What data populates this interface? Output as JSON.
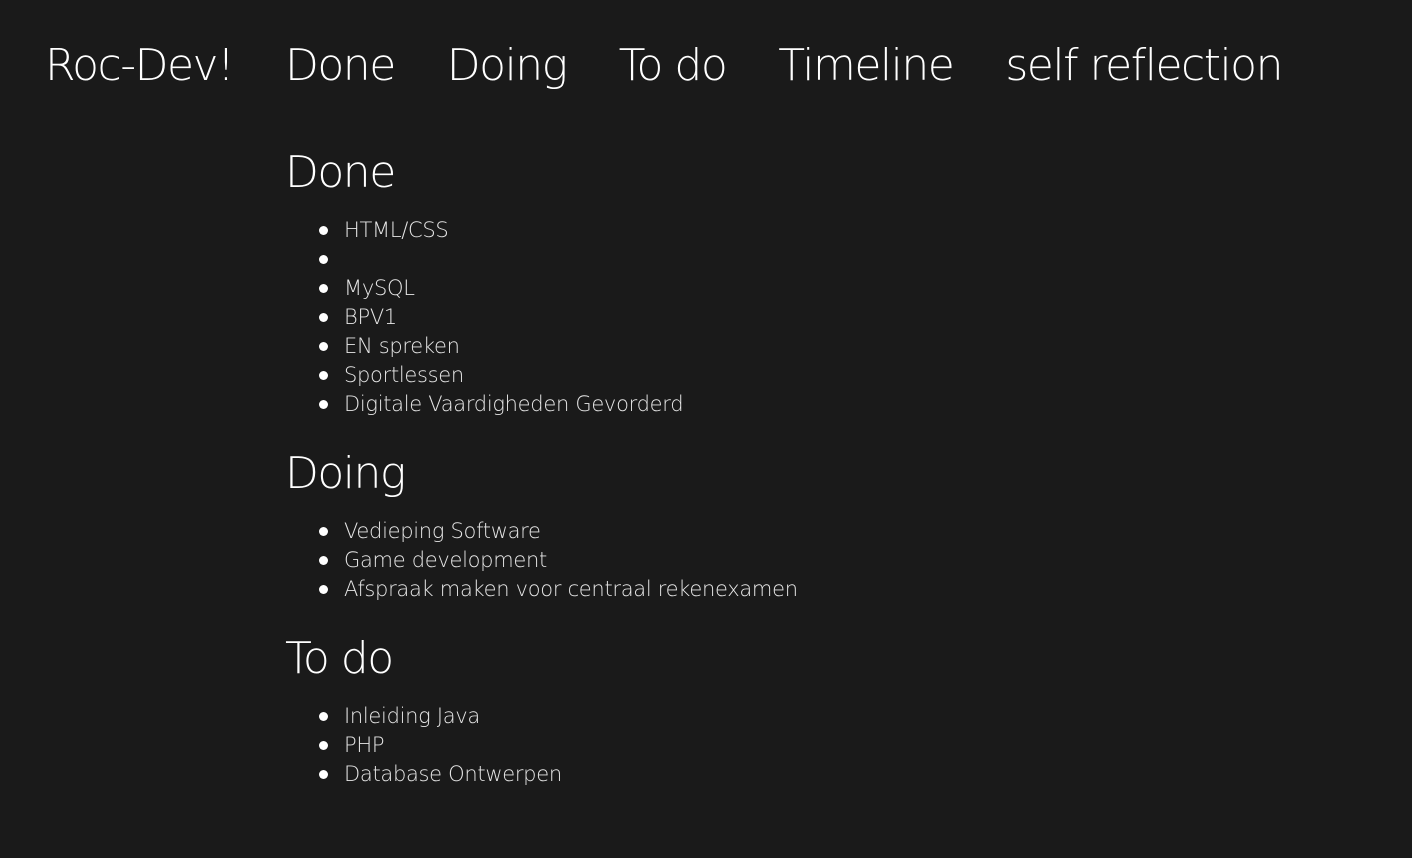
{
  "nav": {
    "brand": "Roc-Dev!",
    "links": [
      "Done",
      "Doing",
      "To do",
      "Timeline",
      "self reflection"
    ]
  },
  "sections": [
    {
      "title": "Done",
      "items": [
        "HTML/CSS",
        "",
        "MySQL",
        "BPV1",
        "EN spreken",
        "Sportlessen",
        "Digitale Vaardigheden Gevorderd"
      ]
    },
    {
      "title": "Doing",
      "items": [
        "Vedieping Software",
        "Game development",
        "Afspraak maken voor centraal rekenexamen"
      ]
    },
    {
      "title": "To do",
      "items": [
        "Inleiding Java",
        "PHP",
        "Database Ontwerpen"
      ]
    }
  ],
  "colors": {
    "background": "#1a1a1a",
    "text": "#ffffff",
    "list_text": "#e6e6e6"
  }
}
